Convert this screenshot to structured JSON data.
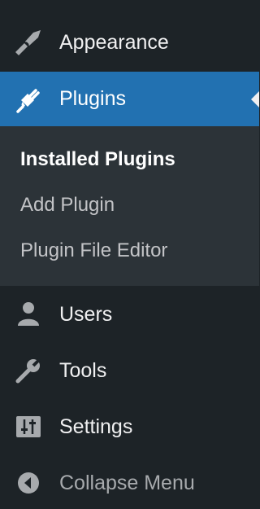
{
  "menu": {
    "appearance": {
      "label": "Appearance",
      "icon": "paintbrush-icon"
    },
    "plugins": {
      "label": "Plugins",
      "icon": "plugin-plug-icon",
      "active_color": "#2271b1",
      "submenu": [
        {
          "label": "Installed Plugins",
          "current": true
        },
        {
          "label": "Add Plugin",
          "current": false
        },
        {
          "label": "Plugin File Editor",
          "current": false
        }
      ]
    },
    "users": {
      "label": "Users",
      "icon": "user-icon"
    },
    "tools": {
      "label": "Tools",
      "icon": "wrench-icon"
    },
    "settings": {
      "label": "Settings",
      "icon": "sliders-icon"
    },
    "collapse": {
      "label": "Collapse Menu",
      "icon": "collapse-arrow-icon"
    }
  },
  "colors": {
    "sidebar_bg": "#1d2327",
    "submenu_bg": "#2c3338",
    "active_bg": "#2271b1",
    "icon_color": "#a7aaad"
  }
}
